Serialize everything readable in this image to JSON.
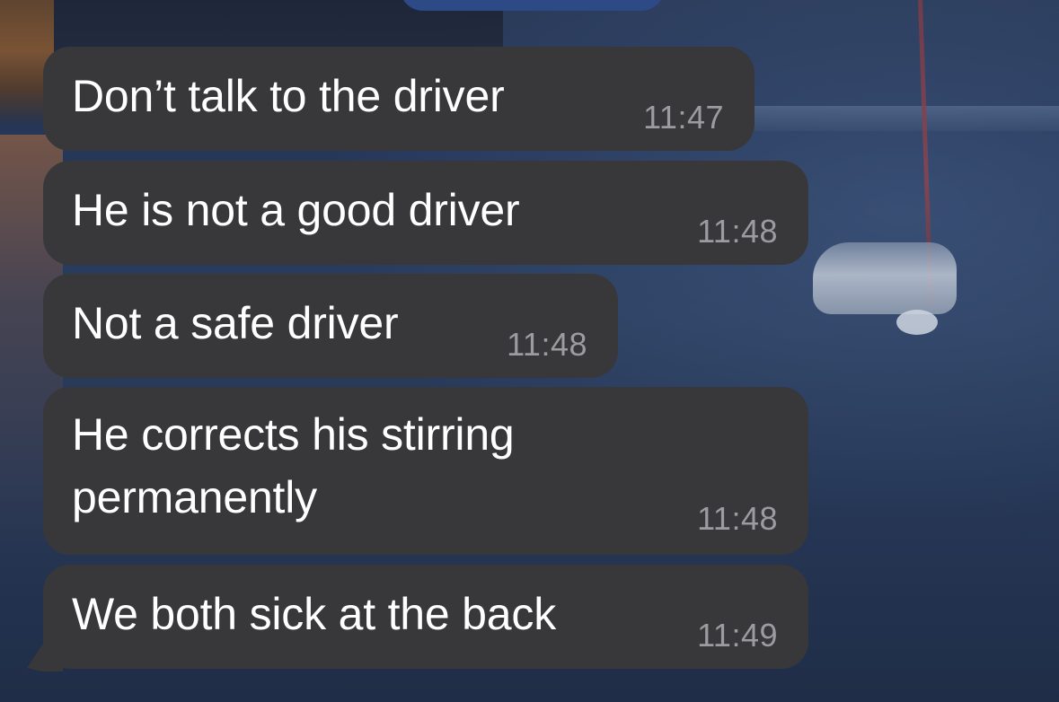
{
  "messages": [
    {
      "text": "Don’t talk to the driver",
      "time": "11:47"
    },
    {
      "text": "He is not a good driver",
      "time": "11:48"
    },
    {
      "text": "Not a safe driver",
      "time": "11:48"
    },
    {
      "text_line1": "He corrects his stirring",
      "text_line2": "permanently",
      "time": "11:48"
    },
    {
      "text": "We both sick at the back",
      "time": "11:49"
    }
  ],
  "colors": {
    "bubble_incoming": "#38383a",
    "bubble_outgoing": "#2d4a86",
    "message_text": "#ffffff",
    "timestamp_text": "#9c9ca0"
  }
}
